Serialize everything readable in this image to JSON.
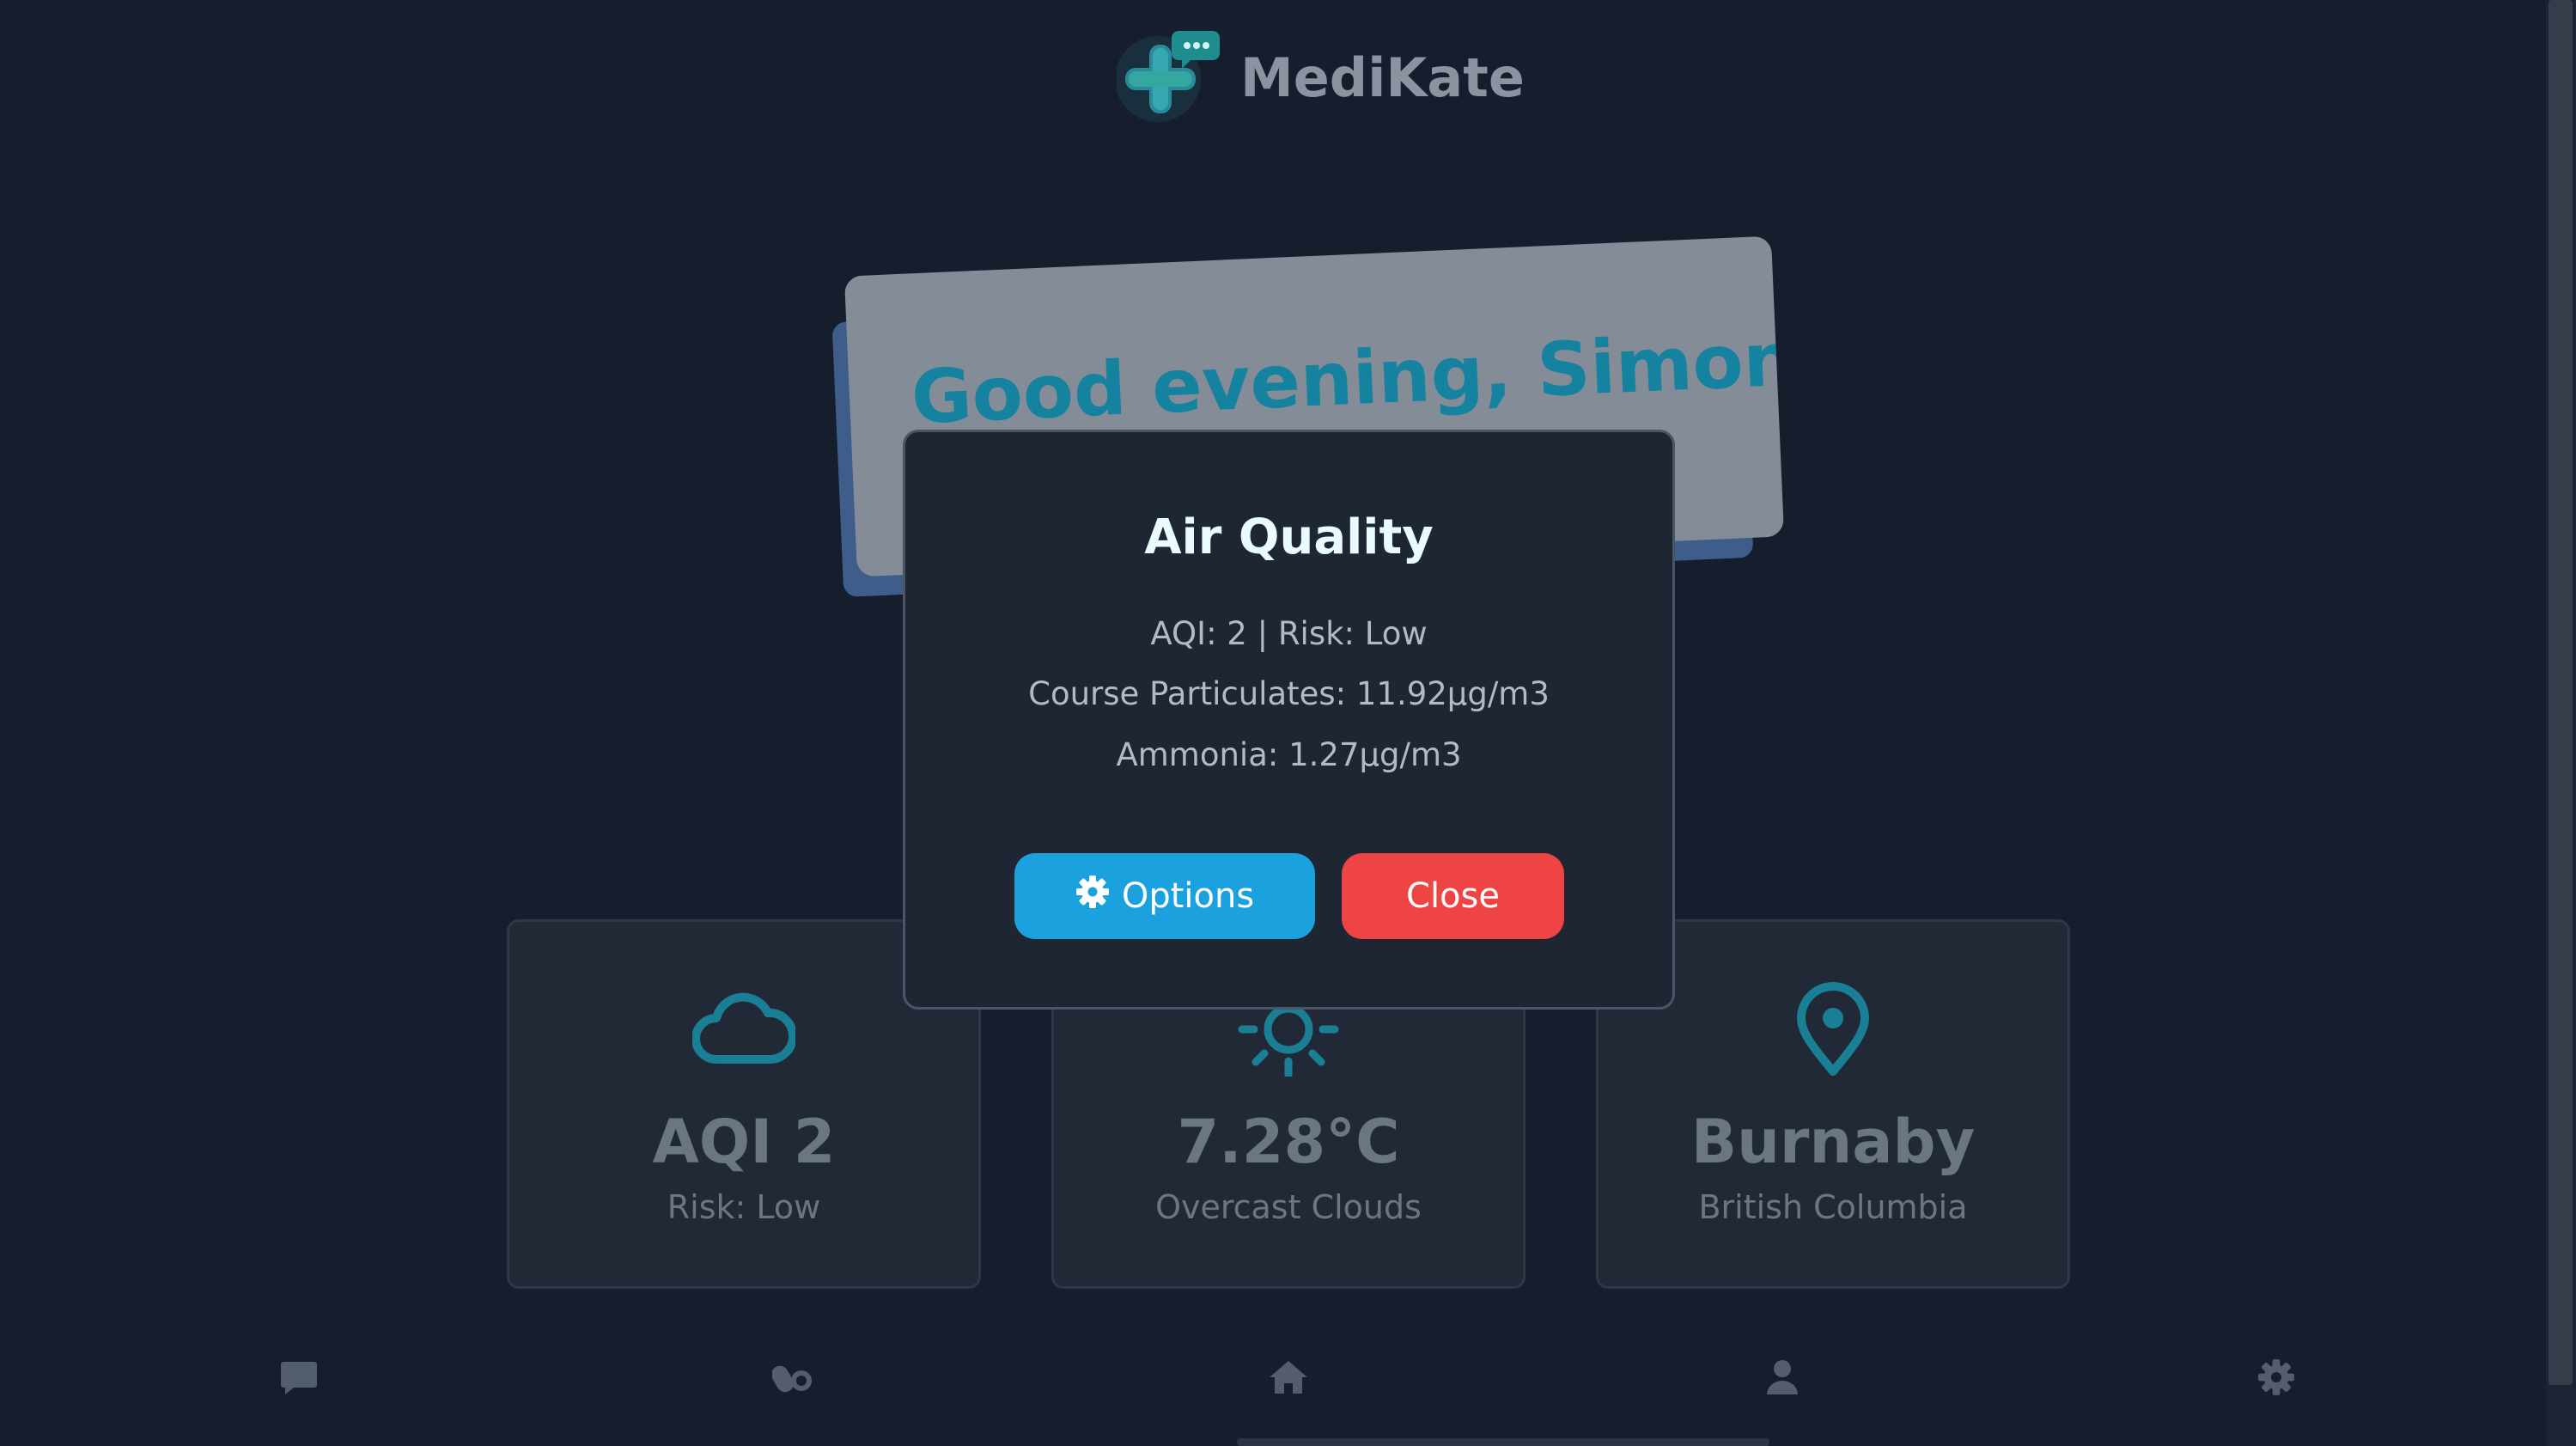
{
  "header": {
    "brand_name": "MediKate"
  },
  "greeting": {
    "text": "Good evening, Simon"
  },
  "cards": [
    {
      "value": "AQI 2",
      "sub": "Risk: Low",
      "icon": "cloud-icon"
    },
    {
      "value": "7.28°C",
      "sub": "Overcast Clouds",
      "icon": "sun-icon"
    },
    {
      "value": "Burnaby",
      "sub": "British Columbia",
      "icon": "location-pin-icon"
    }
  ],
  "modal": {
    "title": "Air Quality",
    "lines": [
      "AQI: 2 | Risk: Low",
      "Course Particulates: 11.92µg/m3",
      "Ammonia: 1.27µg/m3"
    ],
    "options_label": "Options",
    "close_label": "Close"
  },
  "nav": {
    "items": [
      "chat-icon",
      "pills-icon",
      "home-icon",
      "user-icon",
      "gear-icon"
    ]
  },
  "colors": {
    "background": "#161d2c",
    "accent": "#1583a0",
    "options_button": "#1ca1df",
    "close_button": "#ee4444",
    "modal_title": "#e9fbff"
  }
}
